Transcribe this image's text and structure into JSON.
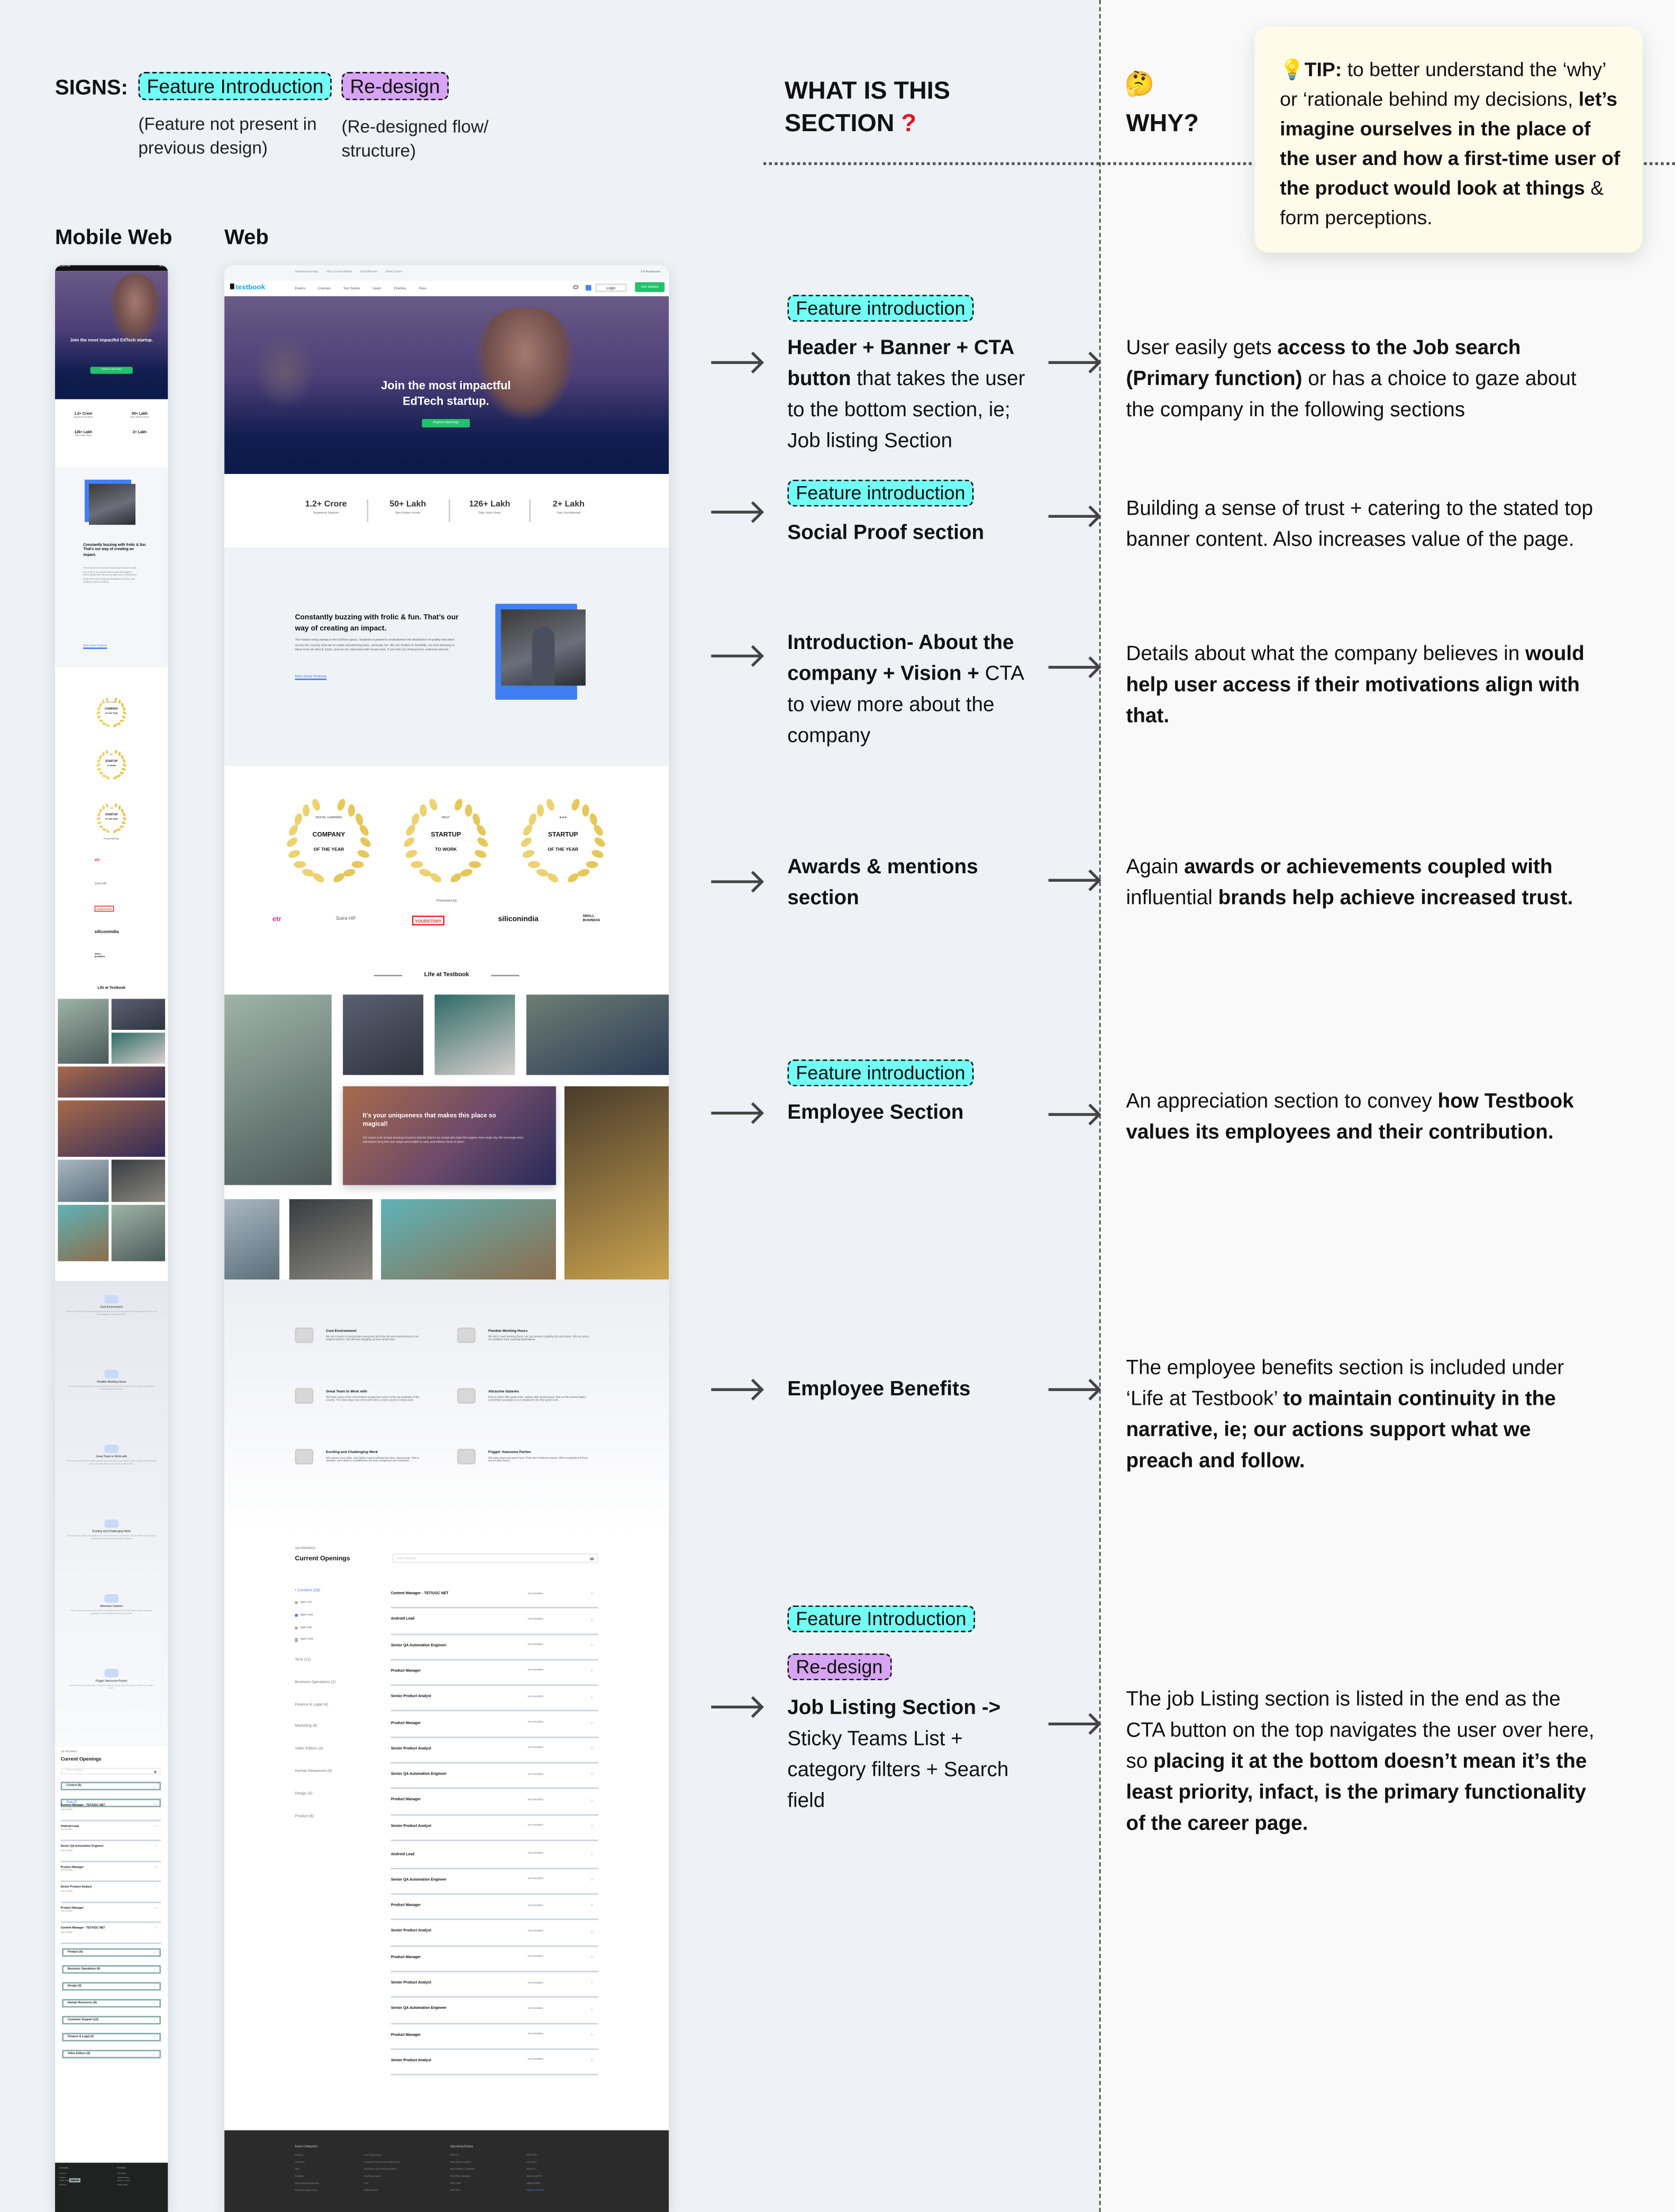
{
  "legend": {
    "signs_label": "SIGNS:",
    "feature_badge": "Feature Introduction",
    "feature_note": "(Feature not present in previous design)",
    "redesign_badge": "Re-design",
    "redesign_note": "(Re-designed flow/ structure)"
  },
  "columns": {
    "mobile_label": "Mobile Web",
    "web_label": "Web",
    "what_title": "WHAT IS THIS SECTION",
    "what_mark": "?",
    "why_emoji": "🤔",
    "why_title": "WHY?"
  },
  "tip": [
    {
      "text": "💡",
      "bold": false
    },
    {
      "text": "TIP:",
      "bold": true
    },
    {
      "text": " to better understand the ‘why’ or ‘rationale behind my decisions, ",
      "bold": false
    },
    {
      "text": "let’s imagine ourselves in the place of the user and how a first-time user of the product would look at things",
      "bold": true
    },
    {
      "text": " & form perceptions.",
      "bold": false
    }
  ],
  "colors": {
    "feature": "#72fff4",
    "redesign": "#d6a4f2",
    "accent_green": "#23c16b",
    "link_blue": "#3f7ff2",
    "tip_bg": "#fffbea"
  },
  "annotations": [
    {
      "badges": [
        {
          "label": "Feature introduction",
          "kind": "feature"
        }
      ],
      "what": [
        {
          "text": "Header + Banner + CTA button",
          "bold": true
        },
        {
          "text": " that takes the user to the bottom section, ie; Job listing Section",
          "bold": false
        }
      ],
      "why": [
        {
          "text": "User easily gets ",
          "bold": false
        },
        {
          "text": "access to the Job search (Primary function)",
          "bold": true
        },
        {
          "text": " or has a choice to gaze about the company in the following sections",
          "bold": false
        }
      ]
    },
    {
      "badges": [
        {
          "label": "Feature introduction",
          "kind": "feature"
        }
      ],
      "what": [
        {
          "text": "Social Proof section",
          "bold": true
        }
      ],
      "why": [
        {
          "text": "Building a sense of trust + catering to the stated top banner content. Also increases value of the page.",
          "bold": false
        }
      ]
    },
    {
      "badges": [],
      "what": [
        {
          "text": "Introduction- About the company + Vision +",
          "bold": true
        },
        {
          "text": " CTA to view more about the company",
          "bold": false
        }
      ],
      "why": [
        {
          "text": "Details about what the company believes in ",
          "bold": false
        },
        {
          "text": "would help user access if their motivations align with that.",
          "bold": true
        }
      ]
    },
    {
      "badges": [],
      "what": [
        {
          "text": "Awards & mentions section",
          "bold": true
        }
      ],
      "why": [
        {
          "text": "Again ",
          "bold": false
        },
        {
          "text": "awards or achievements coupled with",
          "bold": true
        },
        {
          "text": " influential ",
          "bold": false
        },
        {
          "text": "brands help achieve increased trust.",
          "bold": true
        }
      ]
    },
    {
      "badges": [
        {
          "label": "Feature introduction",
          "kind": "feature"
        }
      ],
      "what": [
        {
          "text": "Employee Section",
          "bold": true
        }
      ],
      "why": [
        {
          "text": "An appreciation section to convey ",
          "bold": false
        },
        {
          "text": "how Testbook values its employees and their contribution.",
          "bold": true
        }
      ]
    },
    {
      "badges": [],
      "what": [
        {
          "text": "Employee Benefits",
          "bold": true
        }
      ],
      "why": [
        {
          "text": "The employee benefits section is included under ‘Life at Testbook’ ",
          "bold": false
        },
        {
          "text": "to maintain continuity in the narrative, ie; our actions support what we preach and follow.",
          "bold": true
        }
      ]
    },
    {
      "badges": [
        {
          "label": "Feature Introduction",
          "kind": "feature"
        },
        {
          "label": "Re-design",
          "kind": "redesign"
        }
      ],
      "what": [
        {
          "text": "Job Listing Section ->",
          "bold": true
        },
        {
          "text": " Sticky Teams List + category filters + Search field",
          "bold": false
        }
      ],
      "why": [
        {
          "text": "The job Listing section is listed in the end as the CTA button on the top navigates the user over here, so ",
          "bold": false
        },
        {
          "text": "placing it at the bottom doesn’t mean it’s the least priority, infact, is the primary functionality of the career page.",
          "bold": true
        }
      ]
    }
  ],
  "site": {
    "topbar": [
      "Download our App",
      "GK & Current Affairs",
      "eCard/Promo",
      "Refer & Earn"
    ],
    "topbar_right": "For Businesses",
    "logo": "testbook",
    "nav": [
      "Exams",
      "Courses",
      "Test Series",
      "Learn",
      "Practice",
      "Pass"
    ],
    "login": "Login",
    "get_started": "Get Started",
    "hero_title": "Join the most impactful EdTech startup.",
    "hero_cta": "Explore Openings",
    "stats": [
      {
        "value": "1.2+ Crore",
        "label": "Registered Students"
      },
      {
        "value": "50+ Lakh",
        "label": "New Visitors /month"
      },
      {
        "value": "126+ Lakh",
        "label": "Daily Video Views"
      },
      {
        "value": "2+ Lakh",
        "label": "Daily Test Attempts"
      }
    ],
    "mobile_stat_last_label": "Daily Tests Attempts",
    "intro_title": "Constantly buzzing with frolic & fun. That’s our way of creating an impact.",
    "intro_text": "The fastest rising startup in the EdTech space, Testbook is poised to revolutionise the distribution of quality education across the country. And we’ve made transforming lives, seriously fun. We are fixated on flexibility, we love listening to ideas from all roles & ranks, and we are obsessed with smart-work. If you feel you belong here, welcome aboard.",
    "mobile_intro_text": "The reason to be at work should go beyond a task-list. And it’s our people who make this happen; every single day. We encourage every individual to bring their own unique personalities to work, and embrace those of others.",
    "intro_link": "More About Testbook",
    "awards": [
      {
        "top": "DIGITAL LEARNING",
        "main": "COMPANY",
        "sub": "OF THE YEAR"
      },
      {
        "top": "BEST",
        "main": "STARTUP",
        "sub": "TO WORK"
      },
      {
        "top": "★★★",
        "main": "STARTUP",
        "sub": "OF THE YEAR"
      }
    ],
    "presented_by": "Presented By",
    "logos": [
      "etr",
      "Sutra HR",
      "YOURSTORY",
      "siliconindia",
      "SMALL BUSINESS"
    ],
    "life_title": "Life at Testbook",
    "card_title": "It’s your uniqueness that makes this place so magical!",
    "card_text": "The reason to be at work should go beyond a task-list. And it’s our people who make this happen; every single day. We encourage every individual to bring their own unique personalities to work, and embrace those of others.",
    "benefits": [
      {
        "title": "Cool Environment",
        "text": "We are a bunch of passionate youngsters who like the work environment to be relaxed and fun. You will love hanging out here all the time."
      },
      {
        "title": "Flexible Working Hours",
        "text": "We don’t count working hours, we just believe in getting the work done. We are doers, not mindless hour-counting automatons."
      },
      {
        "title": "Great Team to Work with",
        "text": "We have some of the most brilliant people from some of the top institutes of the country. The initial days may even seem like a crash-course in smart-work."
      },
      {
        "title": "Attractive Salaries",
        "text": "Places which offer great work, seldom offer great money. Not us! We extend highly competitive packages to our employees for their great work."
      },
      {
        "title": "Exciting and Challenging Work",
        "text": "We respect your skills, and rightly expect nothing less than 'spectacular'. Not to mention, your ideas & contributions are duly recognized and rewarded"
      },
      {
        "title": "Friggin’ Awesome Parties",
        "text": "We work smart and party hard. That’s the Testbook mantra. Work is pointless if there are no after-hours.."
      }
    ],
    "openings_count": "118 OPENINGS",
    "openings_title": "Current Openings",
    "search_placeholder": "Search anything",
    "active_category": "• Content (28)",
    "types": [
      {
        "label": "Type 1 (0)",
        "checked": false
      },
      {
        "label": "Type 2 (10)",
        "checked": true
      },
      {
        "label": "Type 3 (8)",
        "checked": false
      },
      {
        "label": "Type 4 (10)",
        "checked": false
      }
    ],
    "categories": [
      "Tech (12)",
      "Business Operations (2)",
      "Finance & Legal (4)",
      "Marketing  (8)",
      "Video Editors (4)",
      "Human Resources (6)",
      "Design (4)",
      "Product  (6)"
    ],
    "location": "NAVI MUMBAI",
    "jobs": [
      "Content Manager - TET/UGC NET",
      "Android Lead",
      "Senior QA Automation Engineer",
      "Product Manager",
      "Senior Product Analyst",
      "Product Manager",
      "Senior Product Analyst",
      "Senior QA Automation Engineer",
      "Product Manager",
      "Senior Product Analyst",
      "Android Lead",
      "Senior QA Automation Engineer",
      "Product Manager",
      "Senior Product Analyst",
      "Product Manager",
      "Senior Product Analyst",
      "Senior QA Automation Engineer",
      "Product Manager",
      "Senior Product Analyst"
    ],
    "footer": {
      "col1_title": "Exam Categories",
      "col1": [
        "Banking",
        "Insurance",
        "SSC",
        "Railways",
        "Mechanical Engineering",
        "Electrical Engineering"
      ],
      "col2": [
        "Civil Engineering",
        "Computer Science and Engineering",
        "Electronics and Communications",
        "Teaching Exams",
        "PSC",
        "Police Exams"
      ],
      "col3_title": "Upcoming Exams",
      "col3": [
        "BOB PO",
        "RRB Office Assistant",
        "Repco Bank Jr Assistant",
        "RBI Office Attendent",
        "IBPS Clerk",
        "RBI Clerk"
      ],
      "col4": [
        "IBPS RRB",
        "HR Scale-I",
        "IBPS PO",
        "Indian Bank PO",
        "Nabard Officer",
        "Explore all Exams"
      ]
    }
  },
  "mobile": {
    "time": "12:34 PM",
    "battery": "80%",
    "mobile_intro_title": "Constantly buzzing with frolic & fun. That’s our way of creating an impact.",
    "accordions_open": [
      {
        "label": "Content   (6)",
        "active": false
      },
      {
        "label": "Tech   (7)",
        "active": true
      }
    ],
    "jobs": [
      "Content Manager - TET/UGC NET",
      "Android Lead",
      "Senior QA Automation Engineer",
      "Product Manager",
      "Senior Product Analyst",
      "Product Manager",
      "Content Manager - TET/UGC NET"
    ],
    "accordions": [
      "Product  (4)",
      "Business Operations  (0)",
      "Design  (2)",
      "Human Resources  (6)",
      "Customer Support  (12)",
      "Finance & Legal  (3)",
      "Video Editors  (0)"
    ],
    "footer_col1_title": "Company",
    "footer_col1": [
      "About us",
      "Careers",
      "Teach Online on Testbook",
      "Partners"
    ],
    "careers_badge": "We are hiring",
    "footer_col2_title": "Products",
    "footer_col2": [
      "Test Series",
      "Testbook Pass",
      "Online Courses",
      "Online Videos"
    ]
  }
}
